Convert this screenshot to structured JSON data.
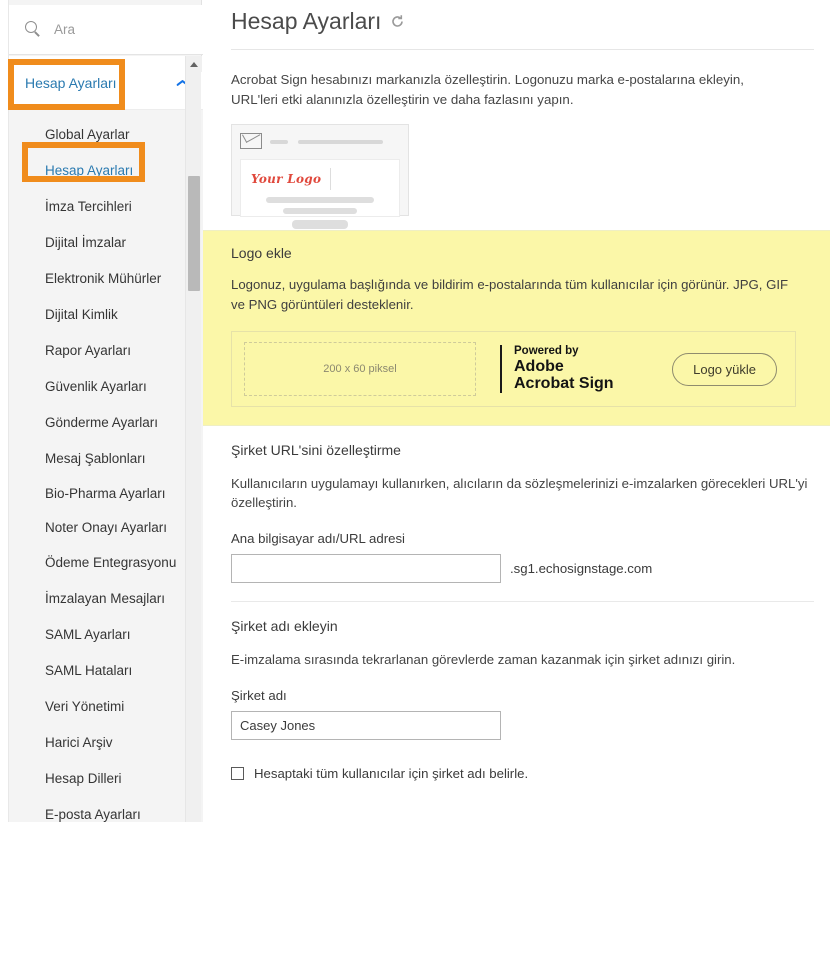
{
  "search": {
    "placeholder": "Ara",
    "icon": "search-icon"
  },
  "sidebar": {
    "header": {
      "label": "Hesap Ayarları",
      "chevron": "chevron-up-icon"
    },
    "items": [
      {
        "label": "Global Ayarlar"
      },
      {
        "label": "Hesap Ayarları"
      },
      {
        "label": "İmza Tercihleri"
      },
      {
        "label": "Dijital İmzalar"
      },
      {
        "label": "Elektronik Mühürler"
      },
      {
        "label": "Dijital Kimlik"
      },
      {
        "label": "Rapor Ayarları"
      },
      {
        "label": "Güvenlik Ayarları"
      },
      {
        "label": "Gönderme Ayarları"
      },
      {
        "label": "Mesaj Şablonları"
      },
      {
        "label": "Bio-Pharma Ayarları"
      },
      {
        "label": "Noter Onayı Ayarları"
      },
      {
        "label": "Ödeme Entegrasyonu"
      },
      {
        "label": "İmzalayan Mesajları"
      },
      {
        "label": "SAML Ayarları"
      },
      {
        "label": "SAML Hataları"
      },
      {
        "label": "Veri Yönetimi"
      },
      {
        "label": "Harici Arşiv"
      },
      {
        "label": "Hesap Dilleri"
      },
      {
        "label": "E-posta Ayarları"
      }
    ]
  },
  "highlight": {
    "color": "#f08c1c"
  },
  "main": {
    "title": "Hesap Ayarları",
    "refresh_icon": "refresh-icon",
    "intro": "Acrobat Sign hesabınızı markanızla özelleştirin. Logonuzu marka e-postalarına ekleyin, URL'leri etki alanınızla özelleştirin ve daha fazlasını yapın.",
    "email_preview": {
      "logo_text": "Your Logo",
      "envelope_icon": "envelope-icon"
    },
    "logo_section": {
      "title": "Logo ekle",
      "description": "Logonuz, uygulama başlığında ve bildirim e-postalarında tüm kullanıcılar için görünür. JPG, GIF ve PNG görüntüleri desteklenir.",
      "placeholder_text": "200 x 60 piksel",
      "brand_powered_by": "Powered by",
      "brand_line1": "Adobe",
      "brand_line2": "Acrobat Sign",
      "upload_button": "Logo yükle",
      "background_color": "#fbf7a8"
    },
    "url_section": {
      "title": "Şirket URL'sini özelleştirme",
      "description": "Kullanıcıların uygulamayı kullanırken, alıcıların da sözleşmelerinizi e-imzalarken görecekleri URL'yi özelleştirin.",
      "field_label": "Ana bilgisayar adı/URL adresi",
      "field_value": "",
      "field_placeholder": "",
      "suffix": ".sg1.echosignstage.com"
    },
    "company_section": {
      "title": "Şirket adı ekleyin",
      "description": "E-imzalama sırasında tekrarlanan görevlerde zaman kazanmak için şirket adınızı girin.",
      "field_label": "Şirket adı",
      "field_value": "Casey Jones",
      "checkbox_label": "Hesaptaki tüm kullanıcılar için şirket adı belirle.",
      "checkbox_checked": false
    }
  }
}
